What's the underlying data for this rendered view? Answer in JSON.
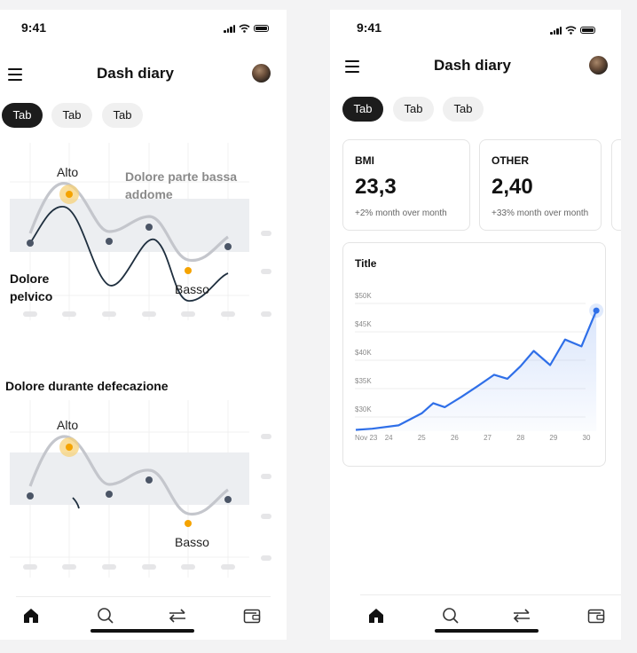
{
  "status_bar": {
    "time": "9:41"
  },
  "header": {
    "title": "Dash diary"
  },
  "tabs": [
    {
      "label": "Tab",
      "active": true
    },
    {
      "label": "Tab",
      "active": false
    },
    {
      "label": "Tab",
      "active": false
    }
  ],
  "left_screen": {
    "chart1": {
      "high_label": "Alto",
      "low_label": "Basso",
      "series_a_label": "Dolore parte bassa addome",
      "series_b_label": "Dolore pelvico"
    },
    "chart2": {
      "title": "Dolore durante defecazione",
      "high_label": "Alto",
      "low_label": "Basso"
    }
  },
  "right_screen": {
    "stats": [
      {
        "label": "BMI",
        "value": "23,3",
        "note": "+2% month over month"
      },
      {
        "label": "OTHER",
        "value": "2,40",
        "note": "+33% month over month"
      }
    ],
    "chart_data": {
      "type": "line",
      "title": "Title",
      "x": [
        "Nov 23",
        "24",
        "25",
        "26",
        "27",
        "28",
        "29",
        "30"
      ],
      "y_ticks": [
        "$50K",
        "$45K",
        "$40K",
        "$35K",
        "$30K"
      ],
      "ylim": [
        25000,
        53000
      ],
      "points": [
        [
          0,
          26800
        ],
        [
          0.5,
          27000
        ],
        [
          1.3,
          27600
        ],
        [
          2,
          29700
        ],
        [
          2.35,
          31500
        ],
        [
          2.7,
          30800
        ],
        [
          3.2,
          32600
        ],
        [
          3.7,
          34500
        ],
        [
          4.2,
          36500
        ],
        [
          4.6,
          35800
        ],
        [
          5.0,
          38000
        ],
        [
          5.4,
          40700
        ],
        [
          5.9,
          38200
        ],
        [
          6.35,
          42700
        ],
        [
          6.85,
          41500
        ],
        [
          7.3,
          47800
        ]
      ],
      "color": "#2f6fe8",
      "grid": true
    }
  },
  "bottom_nav": [
    {
      "name": "home",
      "icon": "home-icon"
    },
    {
      "name": "search",
      "icon": "search-icon"
    },
    {
      "name": "transfer",
      "icon": "transfer-icon"
    },
    {
      "name": "wallet",
      "icon": "wallet-icon"
    }
  ],
  "colors": {
    "accent": "#2f6fe8",
    "warning": "#f5a300",
    "dark": "#1c1c1c",
    "curve_grey": "#c4c6cc",
    "curve_dark": "#1f2f3f"
  }
}
